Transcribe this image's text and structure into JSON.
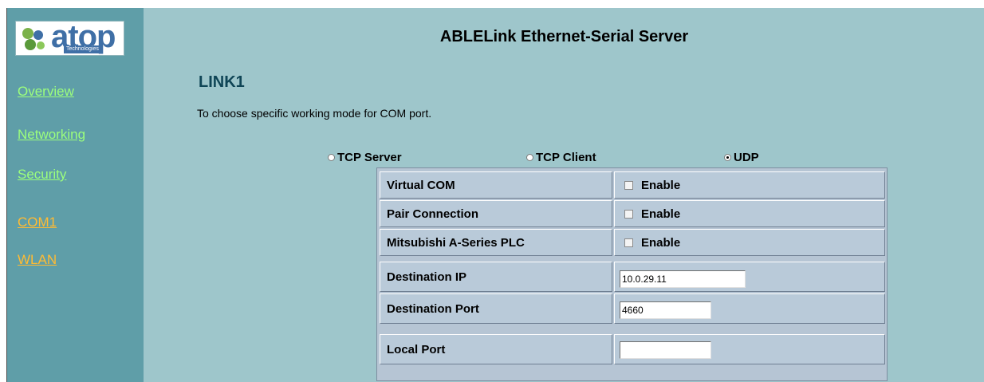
{
  "logo": {
    "text": "atop",
    "subtext": "Technologies"
  },
  "sidebar": {
    "items": [
      {
        "label": "Overview"
      },
      {
        "label": "Networking"
      },
      {
        "label": "Security"
      },
      {
        "label": "COM1"
      },
      {
        "label": "WLAN"
      }
    ]
  },
  "header": {
    "title": "ABLELink Ethernet-Serial Server"
  },
  "section": {
    "title": "LINK1",
    "description": "To choose specific working mode for COM port."
  },
  "modes": [
    {
      "label": "TCP Server",
      "checked": false
    },
    {
      "label": "TCP Client",
      "checked": false
    },
    {
      "label": "UDP",
      "checked": true
    }
  ],
  "options": [
    {
      "label": "Virtual COM",
      "control": "Enable",
      "checked": false
    },
    {
      "label": "Pair Connection",
      "control": "Enable",
      "checked": false
    },
    {
      "label": "Mitsubishi A-Series PLC",
      "control": "Enable",
      "checked": false
    }
  ],
  "fields": {
    "destination_ip": {
      "label": "Destination IP",
      "value": "10.0.29.11"
    },
    "destination_port": {
      "label": "Destination Port",
      "value": "4660"
    },
    "local_port": {
      "label": "Local Port",
      "value": ""
    }
  },
  "colors": {
    "sidebar_bg": "#5f9ea8",
    "main_bg": "#9ec6cb",
    "nav_link": "#9cff7c",
    "nav_link_active": "#ffbb33",
    "section_title": "#0f4556",
    "logo_blue": "#3f6fa6"
  }
}
